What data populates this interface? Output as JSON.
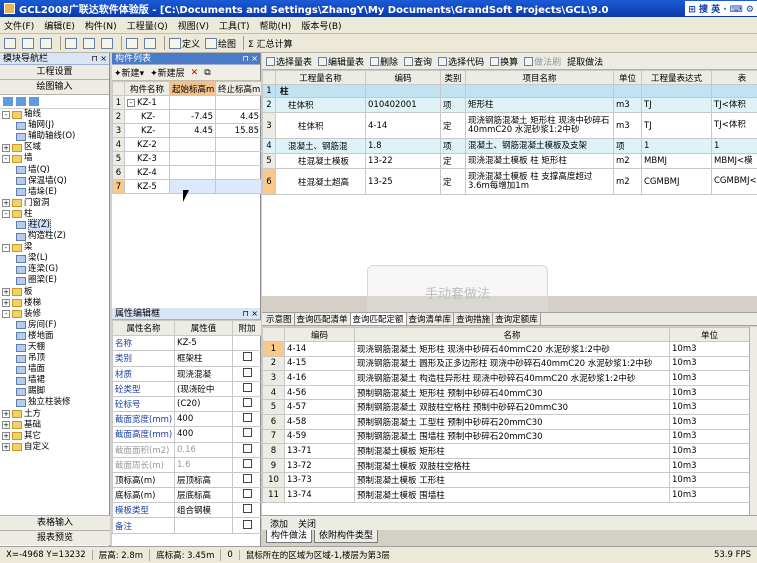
{
  "title_bar": {
    "text": "GCL2008广联达软件体验版 - [C:\\Documents and Settings\\ZhangY\\My Documents\\GrandSoft Projects\\GCL\\9.0",
    "ime": "⊞ 搜 英 · ⌨ ⚙"
  },
  "menu": [
    "文件(F)",
    "编辑(E)",
    "构件(N)",
    "工程量(Q)",
    "视图(V)",
    "工具(T)",
    "帮助(H)",
    "版本号(B)"
  ],
  "toolbar": {
    "define": "定义",
    "draw": "绘图",
    "calc": "Σ 汇总计算"
  },
  "nav": {
    "title": "模块导航栏",
    "buttons": [
      "工程设置",
      "绘图输入"
    ],
    "tree": [
      {
        "label": "轴线",
        "level": 0,
        "type": "folder",
        "expander": "-"
      },
      {
        "label": "轴网(J)",
        "level": 1,
        "type": "leaf"
      },
      {
        "label": "辅助轴线(O)",
        "level": 1,
        "type": "leaf"
      },
      {
        "label": "区域",
        "level": 0,
        "type": "folder",
        "expander": "+"
      },
      {
        "label": "墙",
        "level": 0,
        "type": "folder",
        "expander": "-"
      },
      {
        "label": "墙(Q)",
        "level": 1,
        "type": "leaf"
      },
      {
        "label": "保温墙(Q)",
        "level": 1,
        "type": "leaf"
      },
      {
        "label": "墙垛(E)",
        "level": 1,
        "type": "leaf"
      },
      {
        "label": "门窗洞",
        "level": 0,
        "type": "folder",
        "expander": "+"
      },
      {
        "label": "柱",
        "level": 0,
        "type": "folder",
        "expander": "-"
      },
      {
        "label": "柱(Z)",
        "level": 1,
        "type": "leaf",
        "selected": true
      },
      {
        "label": "构造柱(Z)",
        "level": 1,
        "type": "leaf"
      },
      {
        "label": "梁",
        "level": 0,
        "type": "folder",
        "expander": "-"
      },
      {
        "label": "梁(L)",
        "level": 1,
        "type": "leaf"
      },
      {
        "label": "连梁(G)",
        "level": 1,
        "type": "leaf"
      },
      {
        "label": "圈梁(E)",
        "level": 1,
        "type": "leaf"
      },
      {
        "label": "板",
        "level": 0,
        "type": "folder",
        "expander": "+"
      },
      {
        "label": "楼梯",
        "level": 0,
        "type": "folder",
        "expander": "+"
      },
      {
        "label": "装修",
        "level": 0,
        "type": "folder",
        "expander": "-"
      },
      {
        "label": "房间(F)",
        "level": 1,
        "type": "leaf"
      },
      {
        "label": "楼地面",
        "level": 1,
        "type": "leaf"
      },
      {
        "label": "天棚",
        "level": 1,
        "type": "leaf"
      },
      {
        "label": "吊顶",
        "level": 1,
        "type": "leaf"
      },
      {
        "label": "墙面",
        "level": 1,
        "type": "leaf"
      },
      {
        "label": "墙裙",
        "level": 1,
        "type": "leaf"
      },
      {
        "label": "踢脚",
        "level": 1,
        "type": "leaf"
      },
      {
        "label": "独立柱装修",
        "level": 1,
        "type": "leaf"
      },
      {
        "label": "土方",
        "level": 0,
        "type": "folder",
        "expander": "+"
      },
      {
        "label": "基础",
        "level": 0,
        "type": "folder",
        "expander": "+"
      },
      {
        "label": "其它",
        "level": 0,
        "type": "folder",
        "expander": "+"
      },
      {
        "label": "自定义",
        "level": 0,
        "type": "folder",
        "expander": "+"
      }
    ],
    "bottom_buttons": [
      "表格输入",
      "报表预览"
    ]
  },
  "complist": {
    "title": "构件列表",
    "new": "新建",
    "new_layer": "新建层",
    "headers": [
      "构件名称",
      "起始标高m",
      "终止标高m"
    ],
    "rows": [
      {
        "n": "1",
        "name": "KZ-1",
        "exp": "-",
        "s": "",
        "e": ""
      },
      {
        "n": "2",
        "name": "KZ-",
        "exp": "",
        "s": "-7.45",
        "e": "4.45"
      },
      {
        "n": "3",
        "name": "KZ-",
        "exp": "",
        "s": "4.45",
        "e": "15.85"
      },
      {
        "n": "4",
        "name": "KZ-2",
        "exp": "",
        "s": "",
        "e": ""
      },
      {
        "n": "5",
        "name": "KZ-3",
        "exp": "",
        "s": "",
        "e": ""
      },
      {
        "n": "6",
        "name": "KZ-4",
        "exp": "",
        "s": "",
        "e": ""
      },
      {
        "n": "7",
        "name": "KZ-5",
        "exp": "",
        "s": "",
        "e": ""
      }
    ]
  },
  "props": {
    "title": "属性编辑框",
    "headers": [
      "属性名称",
      "属性值",
      "附加"
    ],
    "rows": [
      {
        "name": "名称",
        "value": "KZ-5",
        "style": "pn",
        "cb": false
      },
      {
        "name": "类别",
        "value": "框架柱",
        "style": "pn",
        "cb": true
      },
      {
        "name": "材质",
        "value": "现浇混凝",
        "style": "pn",
        "cb": true
      },
      {
        "name": "砼类型",
        "value": "(现浇砼中",
        "style": "pn",
        "cb": true
      },
      {
        "name": "砼标号",
        "value": "(C20)",
        "style": "pn",
        "cb": true
      },
      {
        "name": "截面宽度(mm)",
        "value": "400",
        "style": "pn",
        "cb": true
      },
      {
        "name": "截面高度(mm)",
        "value": "400",
        "style": "pn",
        "cb": true
      },
      {
        "name": "截面面积(m2)",
        "value": "0.16",
        "style": "pg",
        "cb": true
      },
      {
        "name": "截面周长(m)",
        "value": "1.6",
        "style": "pg",
        "cb": true
      },
      {
        "name": "顶标高(m)",
        "value": "层顶标高",
        "style": "",
        "cb": true
      },
      {
        "name": "底标高(m)",
        "value": "层底标高",
        "style": "",
        "cb": true
      },
      {
        "name": "模板类型",
        "value": "组合钢模",
        "style": "pn",
        "cb": true
      },
      {
        "name": "备注",
        "value": "",
        "style": "pn",
        "cb": true
      }
    ]
  },
  "rtool": [
    "选择量表",
    "编辑量表",
    "删除",
    "查询",
    "选择代码",
    "换算",
    "做法刷",
    "提取做法"
  ],
  "main": {
    "headers": [
      "",
      "工程量名称",
      "编码",
      "类别",
      "项目名称",
      "单位",
      "工程量表达式",
      "表"
    ],
    "rows": [
      {
        "n": "1",
        "cls": "cyanb",
        "name": "柱",
        "code": "",
        "type": "",
        "item": "",
        "unit": "",
        "expr": "",
        "more": ""
      },
      {
        "n": "2",
        "cls": "cyan",
        "name": "柱体积",
        "code": "010402001",
        "type": "项",
        "item": "矩形柱",
        "unit": "m3",
        "expr": "TJ",
        "more": "TJ<体积"
      },
      {
        "n": "3",
        "cls": "",
        "name": "柱体积",
        "code": "4-14",
        "type": "定",
        "item": "现浇钢筋混凝土 矩形柱 现浇中砂碎石40mmC20 水泥砂浆1:2中砂",
        "unit": "m3",
        "expr": "TJ",
        "more": "TJ<体积"
      },
      {
        "n": "4",
        "cls": "cyan",
        "name": "混凝土、钢筋混",
        "code": "1.8",
        "type": "项",
        "item": "混凝土、钢筋混凝土模板及支架",
        "unit": "项",
        "expr": "1",
        "more": "1"
      },
      {
        "n": "5",
        "cls": "",
        "name": "柱混凝土模板",
        "code": "13-22",
        "type": "定",
        "item": "现浇混凝土模板 柱 矩形柱",
        "unit": "m2",
        "expr": "MBMJ",
        "more": "MBMJ<模"
      },
      {
        "n": "6",
        "cls": "orn",
        "name": "柱混凝土超高",
        "code": "13-25",
        "type": "定",
        "item": "现浇混凝土模板 柱 支撑高度超过3.6m每增加1m",
        "unit": "m2",
        "expr": "CGMBMJ",
        "more": "CGMBMJ<超"
      }
    ]
  },
  "ghost": "手动套做法",
  "tabs2": [
    "示意图",
    "查询匹配清单",
    "查询匹配定额",
    "查询清单库",
    "查询措施",
    "查询定额库"
  ],
  "sub": {
    "headers": [
      "",
      "编码",
      "名称",
      "单位"
    ],
    "rows": [
      {
        "n": "1",
        "code": "4-14",
        "name": "现浇钢筋混凝土 矩形柱 现浇中砂碎石40mmC20 水泥砂浆1:2中砂",
        "unit": "10m3"
      },
      {
        "n": "2",
        "code": "4-15",
        "name": "现浇钢筋混凝土 圆形及正多边形柱 现浇中砂碎石40mmC20 水泥砂浆1:2中砂",
        "unit": "10m3"
      },
      {
        "n": "3",
        "code": "4-16",
        "name": "现浇钢筋混凝土 构造柱异形柱 现浇中砂碎石40mmC20 水泥砂浆1:2中砂",
        "unit": "10m3"
      },
      {
        "n": "4",
        "code": "4-56",
        "name": "预制钢筋混凝土 矩形柱 预制中砂碎石40mmC30",
        "unit": "10m3"
      },
      {
        "n": "5",
        "code": "4-57",
        "name": "预制钢筋混凝土 双肢柱空格柱 预制中砂碎石20mmC30",
        "unit": "10m3"
      },
      {
        "n": "6",
        "code": "4-58",
        "name": "预制钢筋混凝土 工型柱 预制中砂碎石20mmC30",
        "unit": "10m3"
      },
      {
        "n": "7",
        "code": "4-59",
        "name": "预制钢筋混凝土 围墙柱 预制中砂碎石20mmC30",
        "unit": "10m3"
      },
      {
        "n": "8",
        "code": "13-71",
        "name": "预制混凝土模板 矩形柱",
        "unit": "10m3"
      },
      {
        "n": "9",
        "code": "13-72",
        "name": "预制混凝土模板 双肢柱空格柱",
        "unit": "10m3"
      },
      {
        "n": "10",
        "code": "13-73",
        "name": "预制混凝土模板 工形柱",
        "unit": "10m3"
      },
      {
        "n": "11",
        "code": "13-74",
        "name": "预制混凝土模板 围墙柱",
        "unit": "10m3"
      }
    ]
  },
  "addbar": [
    "添加",
    "关闭"
  ],
  "bottabs": [
    "构件做法",
    "依附构件类型"
  ],
  "status": {
    "coords": "X=-4968 Y=13232",
    "floor_h": "层高: 2.8m",
    "base_h": "底标高: 3.45m",
    "zero": "0",
    "msg": "鼠标所在的区域为区域-1,楼层为第3层",
    "fps": "53.9 FPS"
  }
}
